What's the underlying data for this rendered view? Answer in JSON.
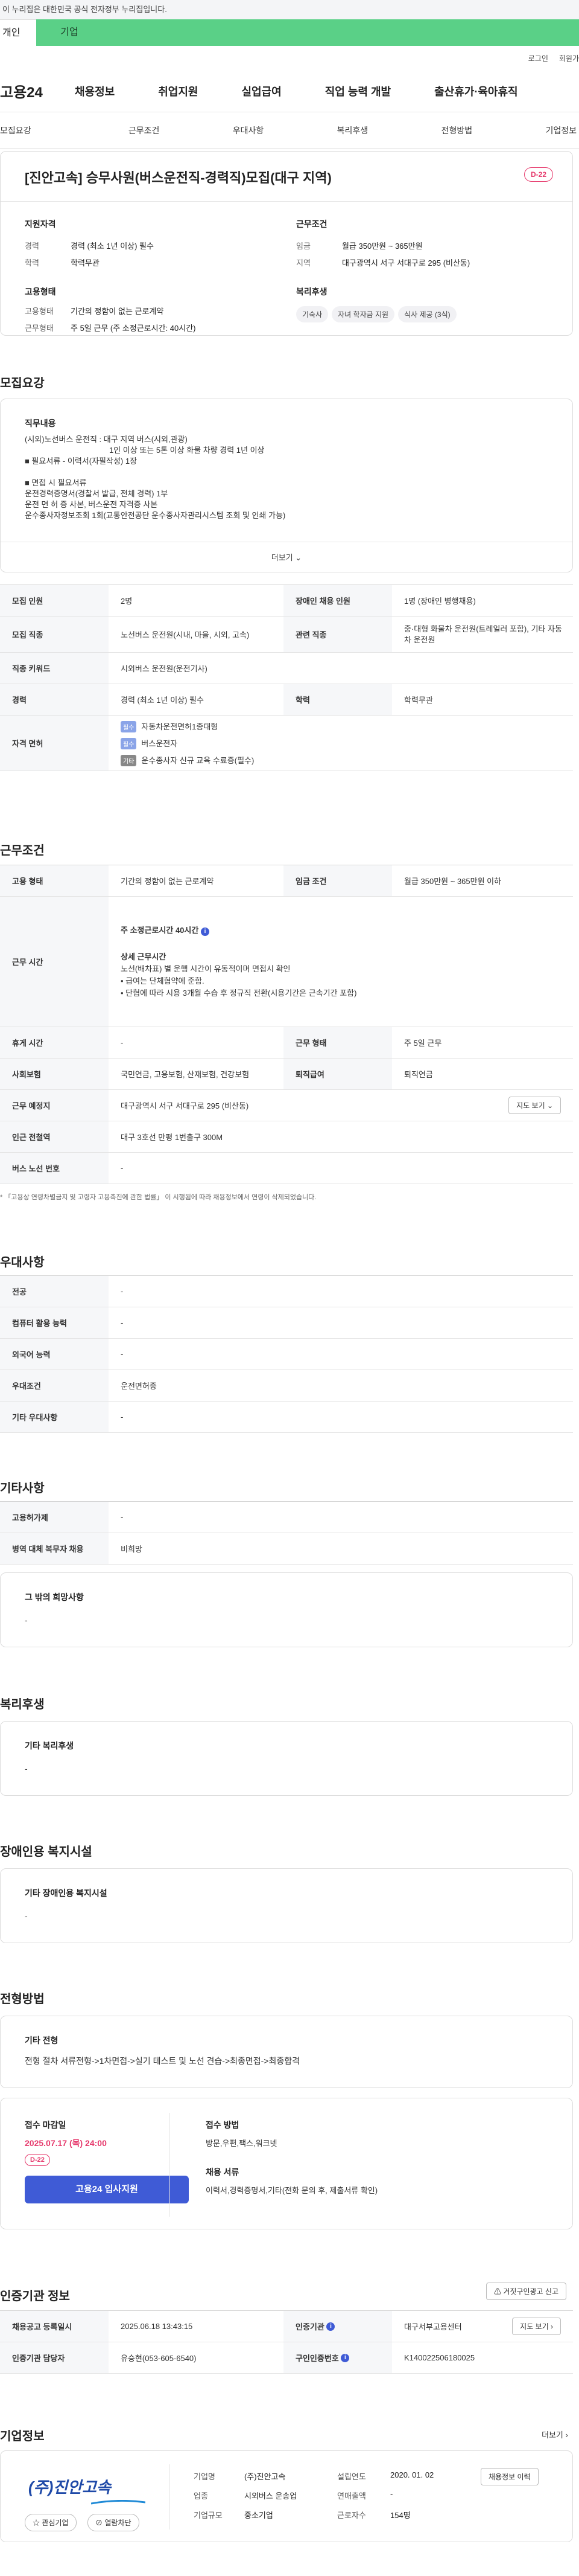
{
  "gov_banner": "이 누리집은 대한민국 공식 전자정부 누리집입니다.",
  "tabs": [
    "개인",
    "기업"
  ],
  "util": [
    "로그인",
    "회원가"
  ],
  "logo": "고용24",
  "gnb": [
    "채용정보",
    "취업지원",
    "실업급여",
    "직업 능력 개발",
    "출산휴가·육아휴직"
  ],
  "anchors": [
    "모집요강",
    "근무조건",
    "우대사항",
    "복리후생",
    "전형방법",
    "기업정보"
  ],
  "job": {
    "title": "[진안고속] 승무사원(버스운전직-경력직)모집(대구 지역)",
    "dday": "D-22",
    "qual_h": "지원자격",
    "career_k": "경력",
    "career_v": "경력 (최소 1년 이상) 필수",
    "edu_k": "학력",
    "edu_v": "학력무관",
    "cond_h": "근무조건",
    "wage_k": "임금",
    "wage_v": "월급 350만원 ~ 365만원",
    "loc_k": "지역",
    "loc_v": "대구광역시 서구 서대구로 295 (비산동)",
    "emp_h": "고용형태",
    "emp_k": "고용형태",
    "emp_v": "기간의 정함이 없는 근로계약",
    "wt_k": "근무형태",
    "wt_v": "주 5일 근무 (주 소정근로시간: 40시간)",
    "welfare_h": "복리후생",
    "chips": [
      "기숙사",
      "자녀 학자금 지원",
      "식사 제공 (3식)"
    ]
  },
  "recruit": {
    "h": "모집요강",
    "duty_h": "직무내용",
    "duty_lines": [
      "(시외)노선버스 운전직 : 대구 지역 버스(시외,관광)",
      "1인 이상 또는 5톤 이상 화물 차량 경력 1년 이상",
      "■ 필요서류 - 이력서(자필작성) 1장",
      "",
      "■ 면접 시 필요서류",
      "운전경력증명서(경찰서 발급, 전체 경력) 1부",
      "운전 면 허 증 사본, 버스운전 자격증 사본",
      "운수종사자정보조회 1회(교통안전공단 운수종사자관리시스템 조회 및 인쇄 가능)"
    ],
    "more": "더보기",
    "t_count_k": "모집 인원",
    "t_count_v": "2명",
    "t_dis_k": "장애인 채용 인원",
    "t_dis_v": "1명 (장애인 병행채용)",
    "t_job_k": "모집 직종",
    "t_job_v": "노선버스 운전원(시내, 마을, 시외, 고속)",
    "t_rel_k": "관련 직종",
    "t_rel_v": "중·대형 화물차 운전원(트레일러 포함), 기타 자동차 운전원",
    "t_kw_k": "직종 키워드",
    "t_kw_v": "시외버스 운전원(운전기사)",
    "t_car_k": "경력",
    "t_car_v": "경력 (최소 1년 이상) 필수",
    "t_edu_k": "학력",
    "t_edu_v": "학력무관",
    "t_lic_k": "자격 면허",
    "lic": [
      {
        "tag": "필수",
        "name": "자동차운전면허1종대형"
      },
      {
        "tag": "필수",
        "name": "버스운전자"
      },
      {
        "tag": "기타",
        "name": "운수종사자 신규 교육 수료증(필수)"
      }
    ]
  },
  "work": {
    "h": "근무조건",
    "emp_k": "고용 형태",
    "emp_v": "기간의 정함이 없는 근로계약",
    "wage_k": "임금 조건",
    "wage_v": "월급 350만원 ~ 365만원 이하",
    "hours_k": "근무 시간",
    "hours_main": "주 소정근로시간 40시간",
    "hours_sub_h": "상세 근무시간",
    "hours_lines": [
      "노선(배차표) 별 운행 시간이 유동적이며 면접시 확인",
      "• 급여는 단체협약에 준함.",
      "• 단협에 따라 시용 3개월 수습 후 정규직 전환(시용기간은 근속기간 포함)"
    ],
    "rest_k": "휴게 시간",
    "rest_v": "-",
    "type_k": "근무 형태",
    "type_v": "주 5일 근무",
    "ins_k": "사회보험",
    "ins_v": "국민연금, 고용보험, 산재보험, 건강보험",
    "ret_k": "퇴직급여",
    "ret_v": "퇴직연금",
    "place_k": "근무 예정지",
    "place_v": "대구광역시 서구 서대구로 295 (비산동)",
    "map_btn": "지도 보기",
    "sub_k": "인근 전철역",
    "sub_v": "대구 3호선 만평 1번출구 300M",
    "bus_k": "버스 노선 번호",
    "bus_v": "-",
    "note": "* 「고용상 연령차별금지 및 고령자 고용촉진에 관한 법률」 이 시행됨에 따라 채용정보에서 연령이 삭제되었습니다."
  },
  "pref": {
    "h": "우대사항",
    "rows": [
      {
        "k": "전공",
        "v": "-"
      },
      {
        "k": "컴퓨터 활용 능력",
        "v": "-"
      },
      {
        "k": "외국어 능력",
        "v": "-"
      },
      {
        "k": "우대조건",
        "v": "운전면허증"
      },
      {
        "k": "기타 우대사항",
        "v": "-"
      }
    ]
  },
  "etc": {
    "h": "기타사항",
    "rows": [
      {
        "k": "고용허가제",
        "v": "-"
      },
      {
        "k": "병역 대체 복무자 채용",
        "v": "비희망"
      }
    ],
    "want_h": "그 밖의 희망사항",
    "want_v": "-"
  },
  "welfare": {
    "h": "복리후생",
    "t": "기타 복리후생",
    "v": "-"
  },
  "facility": {
    "h": "장애인용 복지시설",
    "t": "기타 장애인용 복지시설",
    "v": "-"
  },
  "process": {
    "h": "전형방법",
    "t": "기타 전형",
    "v": "전형 절차 서류전형->1차면접->실기 테스트 및 노선 견습->최종면접->최종합격",
    "deadline_h": "접수 마감일",
    "deadline_v": "2025.07.17 (목) 24:00",
    "dday": "D-22",
    "apply": "고용24 입사지원",
    "method_h": "접수 방법",
    "method_v": "방문,우편,팩스,워크넷",
    "docs_h": "채용 서류",
    "docs_v": "이력서,경력증명서,기타(전화 문의 후, 제출서류 확인)"
  },
  "auth": {
    "h": "인증기관 정보",
    "report_btn": "거짓구인광고 신고",
    "reg_k": "채용공고 등록일시",
    "reg_v": "2025.06.18 13:43:15",
    "org_k": "인증기관",
    "org_v": "대구서부고용센터",
    "map_btn": "지도 보기",
    "mgr_k": "인증기관 담당자",
    "mgr_v": "유승현(053-605-6540)",
    "no_k": "구인인증번호",
    "no_v": "K140022506180025"
  },
  "company": {
    "h": "기업정보",
    "more": "더보기",
    "logo": "(주)진안고속",
    "fav": "관심기업",
    "block": "열람차단",
    "name_k": "기업명",
    "name_v": "(주)진안고속",
    "est_k": "설립연도",
    "est_v": "2020. 01. 02",
    "info_btn": "채용정보 이력",
    "biz_k": "업종",
    "biz_v": "시외버스 운송업",
    "rev_k": "연매출액",
    "rev_v": "-",
    "size_k": "기업규모",
    "size_v": "중소기업",
    "emp_k": "근로자수",
    "emp_v": "154명"
  },
  "colors": {
    "accent": "#3f5bd6",
    "dday": "#e6396c",
    "tab_green": "#5ad087"
  }
}
